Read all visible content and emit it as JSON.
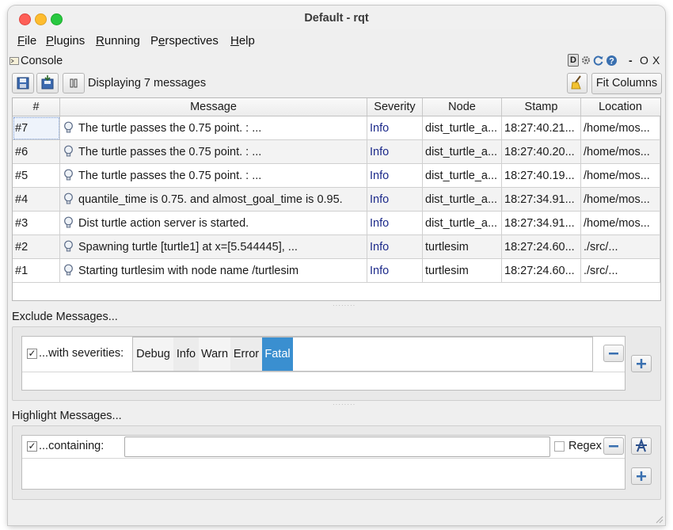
{
  "window": {
    "title": "Default - rqt"
  },
  "menubar": {
    "items": [
      {
        "label": "File",
        "underline": "F",
        "rest": "ile"
      },
      {
        "label": "Plugins",
        "underline": "P",
        "rest": "lugins"
      },
      {
        "label": "Running",
        "underline": "R",
        "rest": "unning"
      },
      {
        "label": "Perspectives",
        "pre": "P",
        "underline": "e",
        "rest": "rspectives"
      },
      {
        "label": "Help",
        "underline": "H",
        "rest": "elp"
      }
    ]
  },
  "dock": {
    "title": "Console",
    "d_label": "D",
    "minus": "-",
    "o": "O",
    "x": "X"
  },
  "toolbar": {
    "status": "Displaying 7 messages",
    "fit_columns": "Fit Columns"
  },
  "table": {
    "headers": [
      "#",
      "Message",
      "Severity",
      "Node",
      "Stamp",
      "Location"
    ],
    "rows": [
      {
        "num": "#7",
        "message": "The turtle passes the 0.75 point.  : ...",
        "severity": "Info",
        "node": "dist_turtle_a...",
        "stamp": "18:27:40.21...",
        "location": "/home/mos..."
      },
      {
        "num": "#6",
        "message": "The turtle passes the 0.75 point.  : ...",
        "severity": "Info",
        "node": "dist_turtle_a...",
        "stamp": "18:27:40.20...",
        "location": "/home/mos..."
      },
      {
        "num": "#5",
        "message": "The turtle passes the 0.75 point.  : ...",
        "severity": "Info",
        "node": "dist_turtle_a...",
        "stamp": "18:27:40.19...",
        "location": "/home/mos..."
      },
      {
        "num": "#4",
        "message": "quantile_time is 0.75. and almost_goal_time is 0.95.",
        "severity": "Info",
        "node": "dist_turtle_a...",
        "stamp": "18:27:34.91...",
        "location": "/home/mos..."
      },
      {
        "num": "#3",
        "message": "Dist turtle action server is started.",
        "severity": "Info",
        "node": "dist_turtle_a...",
        "stamp": "18:27:34.91...",
        "location": "/home/mos..."
      },
      {
        "num": "#2",
        "message": "Spawning turtle [turtle1] at x=[5.544445], ...",
        "severity": "Info",
        "node": "turtlesim",
        "stamp": "18:27:24.60...",
        "location": "./src/..."
      },
      {
        "num": "#1",
        "message": "Starting turtlesim with node name /turtlesim",
        "severity": "Info",
        "node": "turtlesim",
        "stamp": "18:27:24.60...",
        "location": "./src/..."
      }
    ]
  },
  "exclude": {
    "title": "Exclude Messages...",
    "checked": true,
    "check_mark": "✓",
    "label": "...with severities:",
    "severities": [
      "Debug",
      "Info",
      "Warn",
      "Error",
      "Fatal"
    ],
    "selected": "Fatal"
  },
  "highlight": {
    "title": "Highlight Messages...",
    "checked": true,
    "check_mark": "✓",
    "label": "...containing:",
    "input_value": "",
    "regex_label": "Regex",
    "regex_checked": false
  },
  "colors": {
    "accent": "#3a8fd0",
    "severity_text": "#1c2a8a"
  }
}
